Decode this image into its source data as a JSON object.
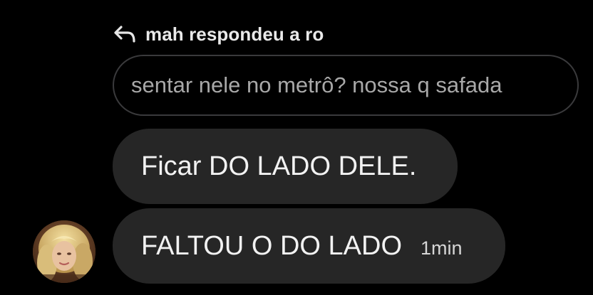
{
  "reply": {
    "icon": "reply-arrow-icon",
    "text": "mah respondeu a ro"
  },
  "quoted_message": {
    "text": "sentar nele no metrô? nossa q safada"
  },
  "messages": [
    {
      "text": "Ficar DO LADO DELE.",
      "time": ""
    },
    {
      "text": "FALTOU O DO LADO",
      "time": "1min"
    }
  ],
  "avatar": {
    "icon": "user-avatar-photo"
  },
  "colors": {
    "background": "#000000",
    "bubble": "#262626",
    "quoted_border": "#3a3a3c",
    "quoted_text": "#a8a8a8",
    "message_text": "#f2f2f2"
  }
}
